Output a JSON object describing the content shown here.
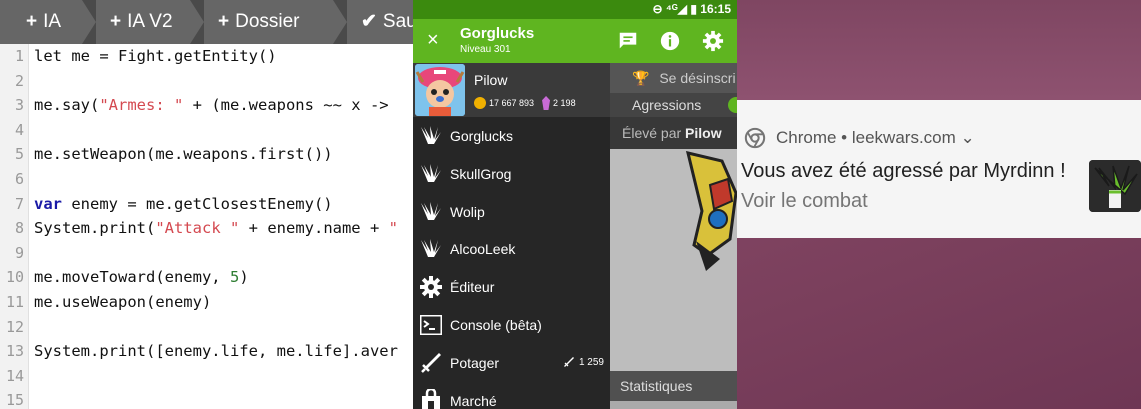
{
  "editor": {
    "tabs": [
      {
        "plus": "+",
        "label": "IA"
      },
      {
        "plus": "+",
        "label": "IA V2"
      },
      {
        "plus": "+",
        "label": "Dossier"
      },
      {
        "plus": "✔",
        "label": "Sauve"
      }
    ],
    "lines": [
      {
        "n": "1",
        "code": [
          {
            "t": "let me = Fight.getEntity()",
            "c": ""
          }
        ]
      },
      {
        "n": "2",
        "code": []
      },
      {
        "n": "3",
        "code": [
          {
            "t": "me.say(",
            "c": ""
          },
          {
            "t": "\"Armes: \"",
            "c": "str"
          },
          {
            "t": " + (me.weapons ~~ x ->",
            "c": ""
          }
        ]
      },
      {
        "n": "4",
        "code": []
      },
      {
        "n": "5",
        "code": [
          {
            "t": "me.setWeapon(me.weapons.first())",
            "c": ""
          }
        ]
      },
      {
        "n": "6",
        "code": []
      },
      {
        "n": "7",
        "code": [
          {
            "t": "var",
            "c": "kw"
          },
          {
            "t": " enemy = me.getClosestEnemy()",
            "c": ""
          }
        ]
      },
      {
        "n": "8",
        "code": [
          {
            "t": "System.print(",
            "c": ""
          },
          {
            "t": "\"Attack \"",
            "c": "str"
          },
          {
            "t": " + enemy.name + ",
            "c": ""
          },
          {
            "t": "\"",
            "c": "str"
          }
        ]
      },
      {
        "n": "9",
        "code": []
      },
      {
        "n": "10",
        "code": [
          {
            "t": "me.moveToward(enemy, ",
            "c": ""
          },
          {
            "t": "5",
            "c": "num"
          },
          {
            "t": ")",
            "c": ""
          }
        ]
      },
      {
        "n": "11",
        "code": [
          {
            "t": "me.useWeapon(enemy)",
            "c": ""
          }
        ]
      },
      {
        "n": "12",
        "code": []
      },
      {
        "n": "13",
        "code": [
          {
            "t": "System.print([enemy.life, me.life].aver",
            "c": ""
          }
        ]
      },
      {
        "n": "14",
        "code": []
      },
      {
        "n": "15",
        "code": []
      }
    ]
  },
  "app": {
    "status": {
      "icons": "⊖ ⁴ᴳ◢ ▮",
      "time": "16:15"
    },
    "appbar": {
      "title": "Gorglucks",
      "subtitle": "Niveau 301",
      "close_icon": "×"
    },
    "profile": {
      "name": "Pilow",
      "habs": "17 667 893",
      "crystals": "2 198"
    },
    "menu": [
      {
        "label": "Gorglucks",
        "icon": "leek-logo-icon"
      },
      {
        "label": "SkullGrog",
        "icon": "leek-logo-icon"
      },
      {
        "label": "Wolip",
        "icon": "leek-logo-icon"
      },
      {
        "label": "AlcooLeek",
        "icon": "leek-logo-icon"
      },
      {
        "label": "Éditeur",
        "icon": "gear-icon"
      },
      {
        "label": "Console (bêta)",
        "icon": "terminal-icon"
      },
      {
        "label": "Potager",
        "icon": "sword-icon",
        "badge": "1 259"
      },
      {
        "label": "Marché",
        "icon": "shop-icon"
      }
    ],
    "content": {
      "unsubscribe": "Se désinscri",
      "tab_aggressions": "Agressions",
      "raised_by_prefix": "Élevé par ",
      "raised_by_name": "Pilow",
      "stats": "Statistiques"
    }
  },
  "notification": {
    "app_line": "Chrome • leekwars.com",
    "chevron": "⌄",
    "title": "Vous avez été agressé par Myrdinn !",
    "action": "Voir le combat"
  },
  "colors": {
    "app_green": "#5fb520",
    "status_green": "#3b8a0e",
    "drawer_bg": "#262626",
    "wallpaper": "#7a3f5c"
  }
}
